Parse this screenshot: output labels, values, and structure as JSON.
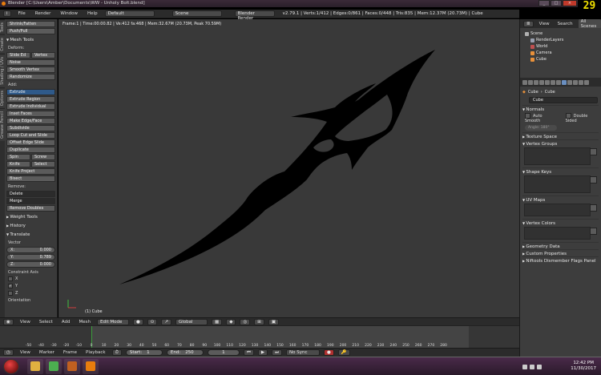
{
  "window": {
    "title": "Blender [C:\\Users\\Amber\\Documents\\WW - Unholy Bolt.blend]",
    "fps": "29"
  },
  "info_header": {
    "menus": [
      "File",
      "Render",
      "Window",
      "Help"
    ],
    "layout": "Default",
    "scene": "Scene",
    "engine": "Blender Render",
    "stats": "v2.79.1 | Verts:1/412 | Edges:0/861 | Faces:0/448 | Tris:835 | Mem:12.37M (20.73M) | Cube"
  },
  "tool_tabs": [
    "Tools",
    "Create",
    "Shading / UVs",
    "Options",
    "Grease Pencil"
  ],
  "toolshelf": {
    "top_buttons": [
      "Shrink/Fatten",
      "Push/Pull"
    ],
    "mesh_tools_header": "Mesh Tools",
    "deform_label": "Deform:",
    "deform_row": [
      "Slide Ed",
      "Vertex"
    ],
    "deform_buttons": [
      "Noise",
      "Smooth Vertex",
      "Randomize"
    ],
    "add_label": "Add:",
    "extrude": "Extrude",
    "add_buttons": [
      "Extrude Region",
      "Extrude Individual",
      "Inset Faces",
      "Make Edge/Face",
      "Subdivide",
      "Loop Cut and Slide",
      "Offset Edge Slide",
      "Duplicate"
    ],
    "spin_row": [
      "Spin",
      "Screw"
    ],
    "knife_row": [
      "Knife",
      "Select"
    ],
    "add_buttons2": [
      "Knife Project",
      "Bisect"
    ],
    "remove_label": "Remove:",
    "delete": "Delete",
    "merge": "Merge",
    "remove_doubles": "Remove Doubles",
    "weight_tools": "Weight Tools",
    "history": "History",
    "translate": "Translate",
    "vector_label": "Vector",
    "vector": [
      {
        "axis": "X:",
        "value": "0.000"
      },
      {
        "axis": "Y:",
        "value": "0.789"
      },
      {
        "axis": "Z:",
        "value": "0.000"
      }
    ],
    "constraint_label": "Constraint Axis",
    "constraint": [
      {
        "axis": "X",
        "checked": false
      },
      {
        "axis": "Y",
        "checked": true
      },
      {
        "axis": "Z",
        "checked": false
      }
    ],
    "orientation_label": "Orientation"
  },
  "viewport": {
    "info": "Frame:1 | Time:00:00.82 | Ve:412 fa:468 | Mem:32.67M (20.73M, Peak 70.59M)",
    "object_label": "(1) Cube",
    "blade_color": "#000000"
  },
  "view3d_header": {
    "menus": [
      "View",
      "Select",
      "Add",
      "Mesh"
    ],
    "mode": "Edit Mode",
    "orientation": "Global"
  },
  "timeline": {
    "ticks": [
      "-50",
      "-40",
      "-30",
      "-20",
      "-10",
      "0",
      "10",
      "20",
      "30",
      "40",
      "50",
      "60",
      "70",
      "80",
      "90",
      "100",
      "110",
      "120",
      "130",
      "140",
      "150",
      "160",
      "170",
      "180",
      "190",
      "200",
      "210",
      "220",
      "230",
      "240",
      "250",
      "260",
      "270",
      "280"
    ],
    "current_frame": 1,
    "menus": [
      "View",
      "Marker",
      "Frame",
      "Playback"
    ],
    "start_label": "Start:",
    "start": "1",
    "end_label": "End:",
    "end": "250",
    "frame": "1",
    "sync": "No Sync"
  },
  "outliner": {
    "tabs": [
      "View",
      "Search",
      "All Scenes"
    ],
    "rows": [
      {
        "name": "Scene",
        "indent": 0,
        "color": "#b0b0b0"
      },
      {
        "name": "RenderLayers",
        "indent": 1,
        "color": "#9aa0b0"
      },
      {
        "name": "World",
        "indent": 1,
        "color": "#c05050"
      },
      {
        "name": "Camera",
        "indent": 1,
        "color": "#e8903a"
      },
      {
        "name": "Cube",
        "indent": 1,
        "color": "#e8903a"
      }
    ]
  },
  "properties": {
    "path": [
      "Cube",
      "Cube"
    ],
    "mesh_name": "Cube",
    "normals": "Normals",
    "auto_smooth": "Auto Smooth",
    "double_sided": "Double Sided",
    "angle": "Angle: 180°",
    "texture_space": "Texture Space",
    "vertex_groups": "Vertex Groups",
    "shape_keys": "Shape Keys",
    "uv_maps": "UV Maps",
    "vertex_colors": "Vertex Colors",
    "geometry_data": "Geometry Data",
    "custom_properties": "Custom Properties",
    "niftools": "Niftools Dismember Flags Panel"
  },
  "taskbar": {
    "time": "12:42 PM",
    "date": "11/30/2017",
    "apps": [
      {
        "name": "folder",
        "color": "#e0b040"
      },
      {
        "name": "chrome",
        "color": "#4caf50"
      },
      {
        "name": "media",
        "color": "#c06020"
      },
      {
        "name": "blender",
        "color": "#e87d0d"
      }
    ]
  }
}
